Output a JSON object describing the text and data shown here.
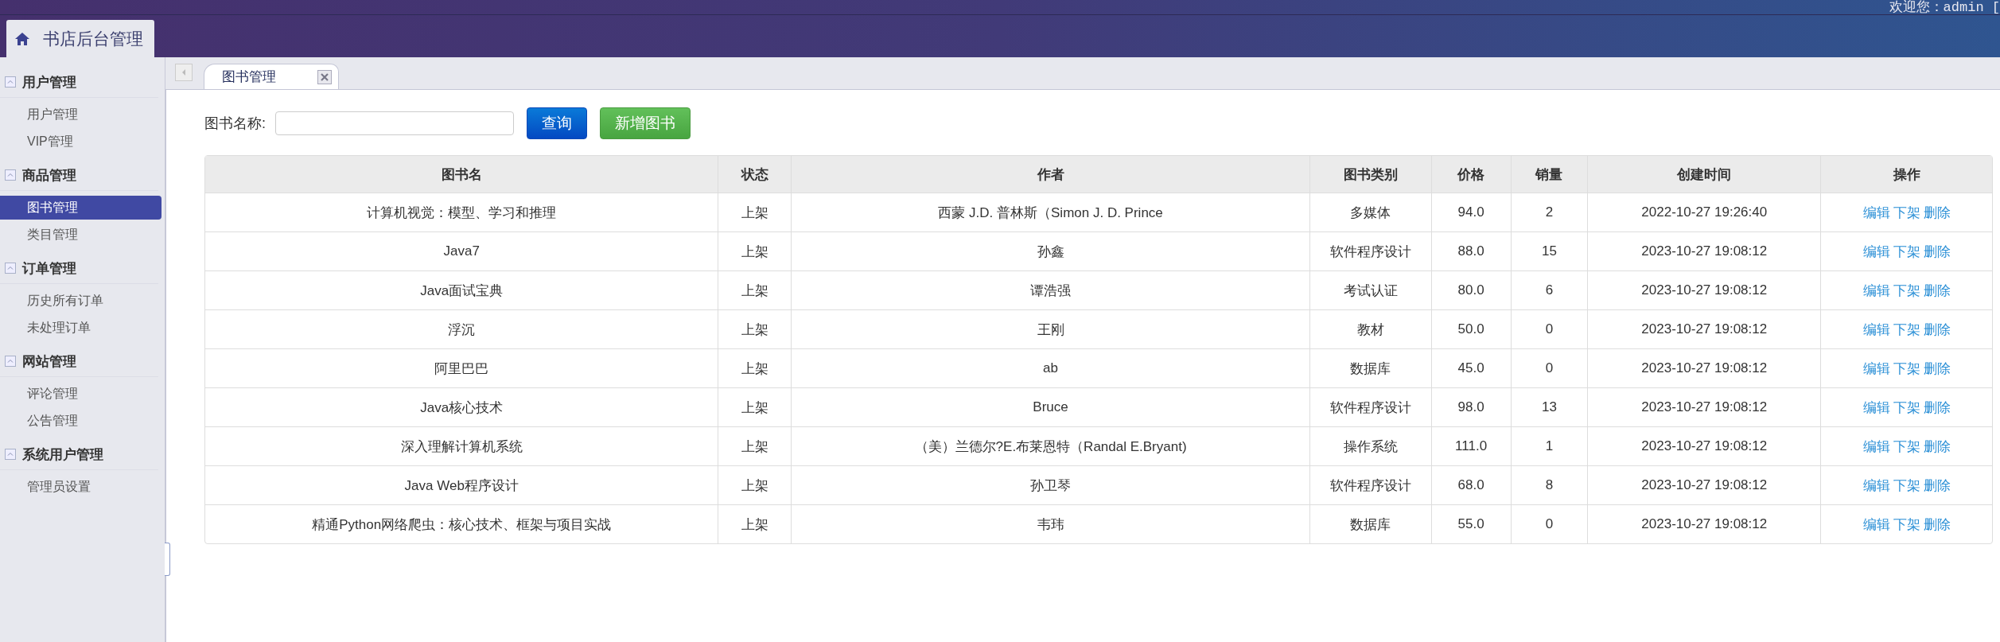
{
  "header": {
    "title": "书店后台管理",
    "welcome": "欢迎您：admin ["
  },
  "sidebar": {
    "groups": [
      {
        "title": "用户管理",
        "expanded": true,
        "items": [
          {
            "label": "用户管理",
            "selected": false
          },
          {
            "label": "VIP管理",
            "selected": false
          }
        ]
      },
      {
        "title": "商品管理",
        "expanded": true,
        "items": [
          {
            "label": "图书管理",
            "selected": true
          },
          {
            "label": "类目管理",
            "selected": false
          }
        ]
      },
      {
        "title": "订单管理",
        "expanded": true,
        "items": [
          {
            "label": "历史所有订单",
            "selected": false
          },
          {
            "label": "未处理订单",
            "selected": false
          }
        ]
      },
      {
        "title": "网站管理",
        "expanded": true,
        "items": [
          {
            "label": "评论管理",
            "selected": false
          },
          {
            "label": "公告管理",
            "selected": false
          }
        ]
      },
      {
        "title": "系统用户管理",
        "expanded": true,
        "items": [
          {
            "label": "管理员设置",
            "selected": false
          }
        ]
      }
    ]
  },
  "tabs": [
    {
      "label": "图书管理",
      "selected": true
    }
  ],
  "search": {
    "label": "图书名称:",
    "query_button": "查询",
    "add_button": "新增图书"
  },
  "table": {
    "columns": [
      "图书名",
      "状态",
      "作者",
      "图书类别",
      "价格",
      "销量",
      "创建时间",
      "操作"
    ],
    "rows": [
      {
        "name": "计算机视觉：模型、学习和推理",
        "status": "上架",
        "author": "西蒙 J.D. 普林斯（Simon J. D. Prince",
        "category": "多媒体",
        "price": "94.0",
        "sales": "2",
        "created": "2022-10-27 19:26:40",
        "actions": [
          "编辑",
          "下架",
          "删除"
        ]
      },
      {
        "name": "Java7",
        "status": "上架",
        "author": "孙鑫",
        "category": "软件程序设计",
        "price": "88.0",
        "sales": "15",
        "created": "2023-10-27 19:08:12",
        "actions": [
          "编辑",
          "下架",
          "删除"
        ]
      },
      {
        "name": "Java面试宝典",
        "status": "上架",
        "author": "谭浩强",
        "category": "考试认证",
        "price": "80.0",
        "sales": "6",
        "created": "2023-10-27 19:08:12",
        "actions": [
          "编辑",
          "下架",
          "删除"
        ]
      },
      {
        "name": "浮沉",
        "status": "上架",
        "author": "王刚",
        "category": "教材",
        "price": "50.0",
        "sales": "0",
        "created": "2023-10-27 19:08:12",
        "actions": [
          "编辑",
          "下架",
          "删除"
        ]
      },
      {
        "name": "阿里巴巴",
        "status": "上架",
        "author": "ab",
        "category": "数据库",
        "price": "45.0",
        "sales": "0",
        "created": "2023-10-27 19:08:12",
        "actions": [
          "编辑",
          "下架",
          "删除"
        ]
      },
      {
        "name": "Java核心技术",
        "status": "上架",
        "author": "Bruce",
        "category": "软件程序设计",
        "price": "98.0",
        "sales": "13",
        "created": "2023-10-27 19:08:12",
        "actions": [
          "编辑",
          "下架",
          "删除"
        ]
      },
      {
        "name": "深入理解计算机系统",
        "status": "上架",
        "author": "（美）兰德尔?E.布莱恩特（Randal E.Bryant)",
        "category": "操作系统",
        "price": "111.0",
        "sales": "1",
        "created": "2023-10-27 19:08:12",
        "actions": [
          "编辑",
          "下架",
          "删除"
        ]
      },
      {
        "name": "Java Web程序设计",
        "status": "上架",
        "author": "孙卫琴",
        "category": "软件程序设计",
        "price": "68.0",
        "sales": "8",
        "created": "2023-10-27 19:08:12",
        "actions": [
          "编辑",
          "下架",
          "删除"
        ]
      },
      {
        "name": "精通Python网络爬虫：核心技术、框架与项目实战",
        "status": "上架",
        "author": "韦玮",
        "category": "数据库",
        "price": "55.0",
        "sales": "0",
        "created": "2023-10-27 19:08:12",
        "actions": [
          "编辑",
          "下架",
          "删除"
        ]
      }
    ]
  }
}
